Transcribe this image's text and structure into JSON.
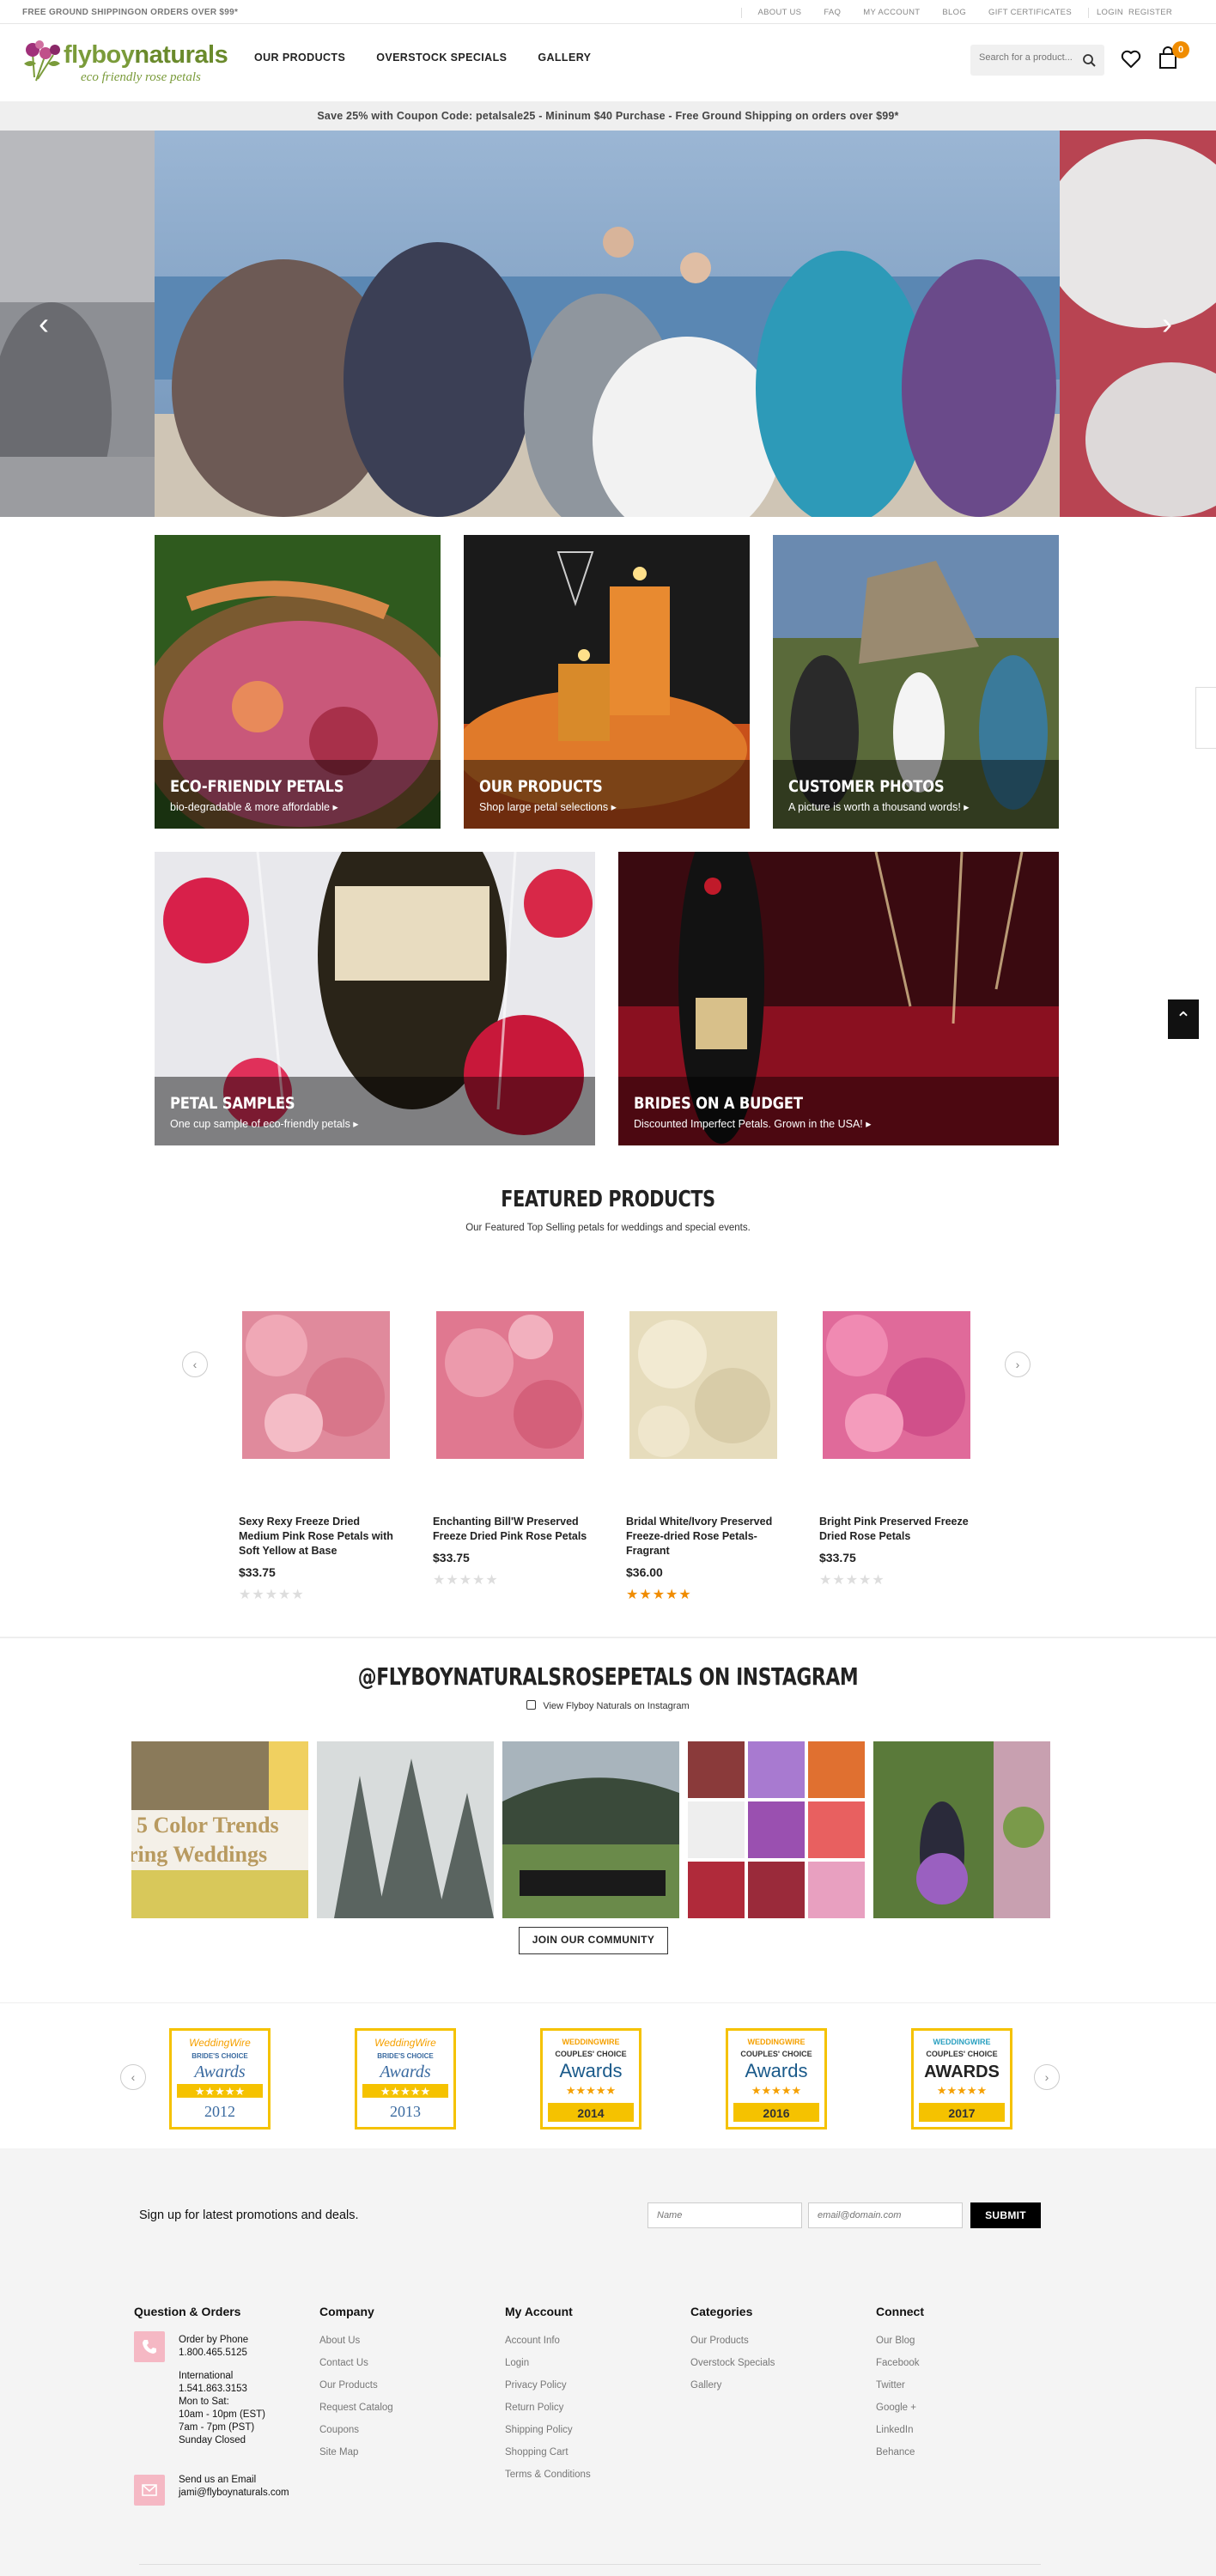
{
  "topbar": {
    "promo": "FREE GROUND SHIPPINGON ORDERS OVER $99*",
    "links": [
      "ABOUT US",
      "FAQ",
      "MY ACCOUNT",
      "BLOG",
      "GIFT CERTIFICATES",
      "LOGIN",
      "REGISTER"
    ]
  },
  "header": {
    "logo_name": "flyboy",
    "logo_name_bold": "naturals",
    "logo_tagline": "eco friendly rose petals",
    "nav": [
      "OUR PRODUCTS",
      "OVERSTOCK SPECIALS",
      "GALLERY"
    ],
    "search_placeholder": "Search for a product...",
    "cart_count": "0"
  },
  "coupon_bar": "Save 25% with Coupon Code: petalsale25 - Mininum $40 Purchase - Free Ground Shipping on orders over $99*",
  "tiles": [
    {
      "title": "ECO-FRIENDLY PETALS",
      "subtitle": "bio-degradable & more affordable ▸"
    },
    {
      "title": "OUR PRODUCTS",
      "subtitle": "Shop large petal selections ▸"
    },
    {
      "title": "CUSTOMER PHOTOS",
      "subtitle": "A picture is worth a thousand words! ▸"
    },
    {
      "title": "PETAL SAMPLES",
      "subtitle": "One cup sample of eco-friendly petals ▸"
    },
    {
      "title": "BRIDES ON A BUDGET",
      "subtitle": "Discounted Imperfect Petals. Grown in the USA! ▸"
    }
  ],
  "featured": {
    "title": "FEATURED PRODUCTS",
    "subtitle": "Our Featured Top Selling petals for weddings and special events.",
    "products": [
      {
        "name": "Sexy Rexy Freeze Dried Medium Pink Rose Petals with Soft Yellow at Base",
        "price": "$33.75",
        "rating": 0
      },
      {
        "name": "Enchanting Bill'W Preserved Freeze Dried Pink Rose Petals",
        "price": "$33.75",
        "rating": 0
      },
      {
        "name": "Bridal White/Ivory Preserved Freeze-dried Rose Petals-Fragrant",
        "price": "$36.00",
        "rating": 5
      },
      {
        "name": "Bright Pink Preserved Freeze Dried Rose Petals",
        "price": "$33.75",
        "rating": 0
      }
    ]
  },
  "instagram": {
    "title": "@FLYBOYNATURALSROSEPETALS ON INSTAGRAM",
    "link": "View Flyboy Naturals on Instagram",
    "tile1_text1": "5 Color Trends",
    "tile1_text2": "ring Weddings",
    "join": "JOIN OUR COMMUNITY"
  },
  "awards": [
    {
      "brand": "WeddingWire",
      "line1": "BRIDE'S CHOICE",
      "line2": "Awards",
      "year": "2012"
    },
    {
      "brand": "WeddingWire",
      "line1": "BRIDE'S CHOICE",
      "line2": "Awards",
      "year": "2013"
    },
    {
      "brand": "WEDDINGWIRE",
      "line1": "COUPLES' CHOICE",
      "line2": "Awards",
      "year": "2014"
    },
    {
      "brand": "WEDDINGWIRE",
      "line1": "COUPLES' CHOICE",
      "line2": "Awards",
      "year": "2016"
    },
    {
      "brand": "WEDDINGWIRE",
      "line1": "COUPLES' CHOICE",
      "line2": "AWARDS",
      "year": "2017"
    }
  ],
  "newsletter": {
    "label": "Sign up for latest promotions and deals.",
    "name_placeholder": "Name",
    "email_placeholder": "email@domain.com",
    "submit": "SUBMIT"
  },
  "footer": {
    "questions": {
      "title": "Question & Orders",
      "phone_label": "Order by Phone",
      "phone": "1.800.465.5125",
      "intl_label": "International",
      "intl_phone": "1.541.863.3153",
      "hours1": "Mon to Sat:",
      "hours2": "10am - 10pm (EST)",
      "hours3": "7am - 7pm (PST)",
      "hours4": "Sunday Closed",
      "email_label": "Send us an Email",
      "email": "jami@flyboynaturals.com"
    },
    "company": {
      "title": "Company",
      "links": [
        "About Us",
        "Contact Us",
        "Our Products",
        "Request Catalog",
        "Coupons",
        "Site Map"
      ]
    },
    "account": {
      "title": "My Account",
      "links": [
        "Account Info",
        "Login",
        "Privacy Policy",
        "Return Policy",
        "Shipping Policy",
        "Shopping Cart",
        "Terms & Conditions"
      ]
    },
    "categories": {
      "title": "Categories",
      "links": [
        "Our Products",
        "Overstock Specials",
        "Gallery"
      ]
    },
    "connect": {
      "title": "Connect",
      "links": [
        "Our Blog",
        "Facebook",
        "Twitter",
        "Google +",
        "LinkedIn",
        "Behance"
      ]
    }
  },
  "colors": {
    "brand_green": "#7a9b3a",
    "accent_orange": "#f08c00",
    "award_gold": "#f5c200"
  }
}
